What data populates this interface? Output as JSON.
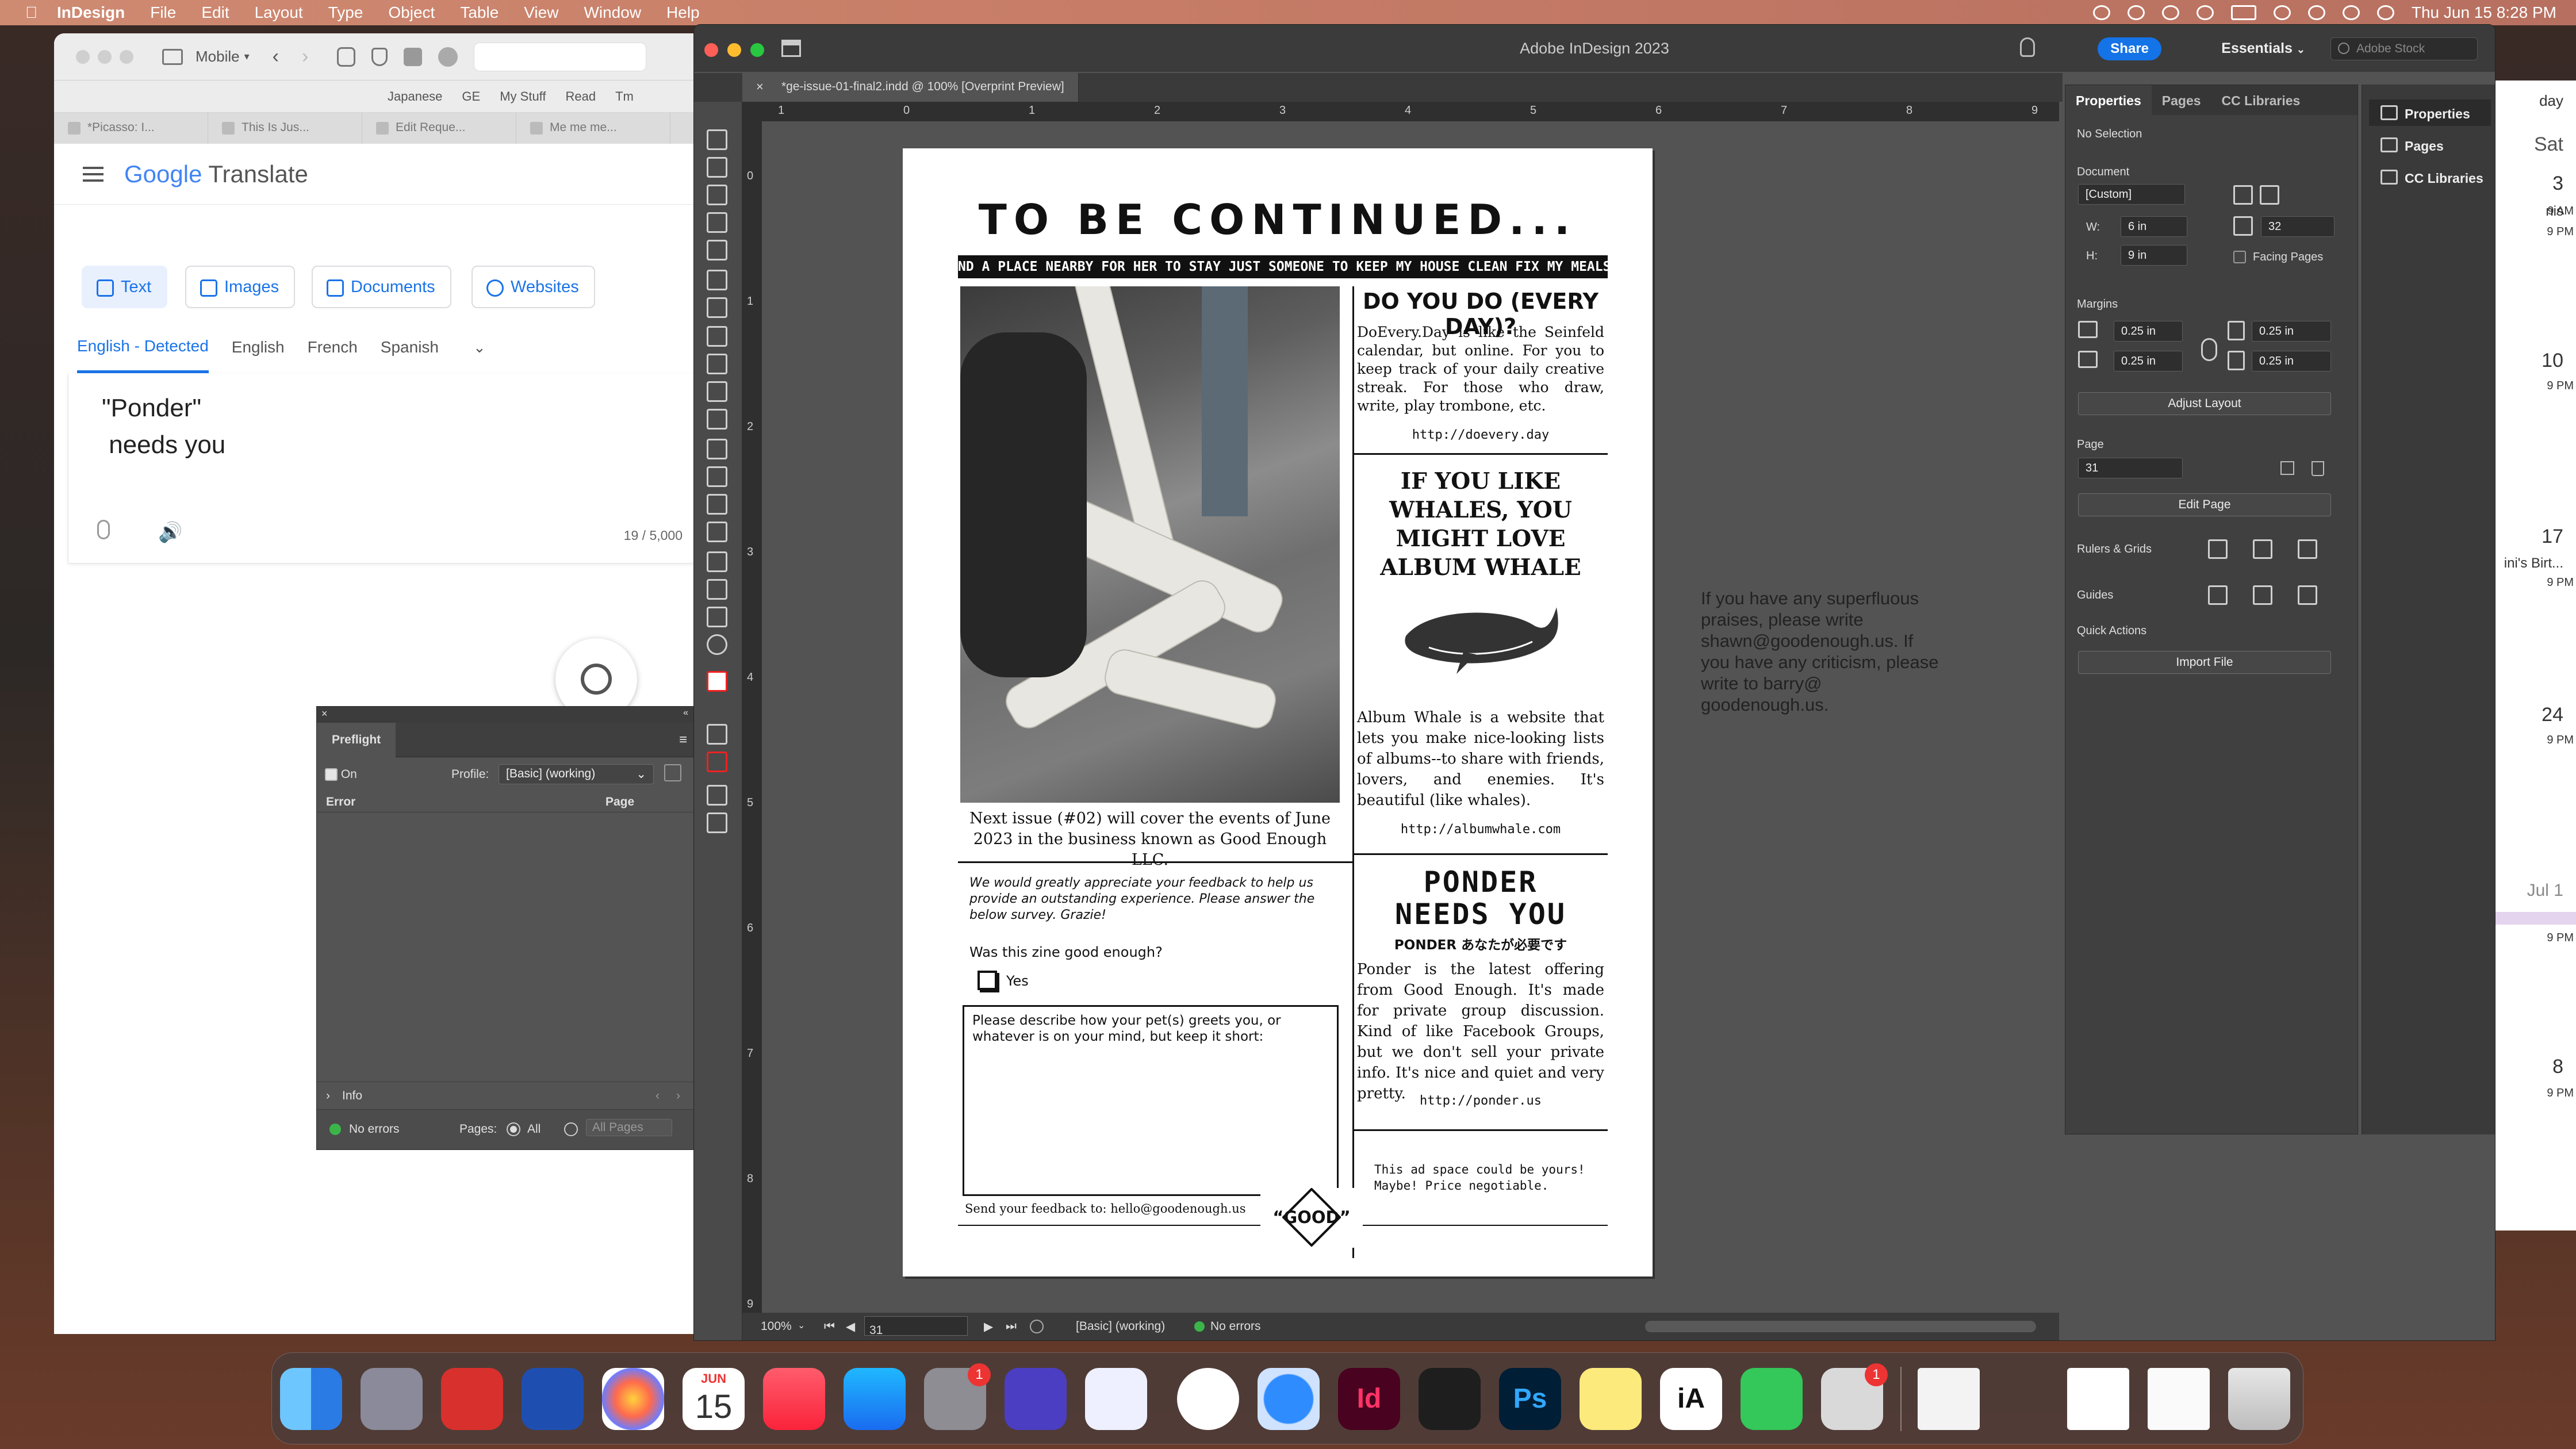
{
  "menubar": {
    "app": "InDesign",
    "items": [
      "File",
      "Edit",
      "Layout",
      "Type",
      "Object",
      "Table",
      "View",
      "Window",
      "Help"
    ],
    "datetime": "Thu Jun 15  8:28 PM"
  },
  "calendar": {
    "header_day": "day",
    "header_sat": "Sat",
    "cells": [
      {
        "date": "3",
        "line1": "nis",
        "line2": "9 AM",
        "line3": "9 PM"
      },
      {
        "date": "10",
        "line1": "",
        "line2": "9 PM",
        "line3": ""
      },
      {
        "date": "17",
        "line1": "ini's Birt...",
        "line2": "9 PM",
        "line3": ""
      },
      {
        "date": "24",
        "line1": "",
        "line2": "9 PM",
        "line3": ""
      },
      {
        "date": "Jul 1",
        "line1": "",
        "line2": "9 PM",
        "line3": ""
      },
      {
        "date": "8",
        "line1": "",
        "line2": "9 PM",
        "line3": ""
      }
    ]
  },
  "browser": {
    "mode": "Mobile",
    "bookmarks": [
      "Japanese",
      "GE",
      "My Stuff",
      "Read",
      "Tm"
    ],
    "tabs": [
      "*Picasso: I...",
      "This Is Jus...",
      "Edit Reque...",
      "Me me me..."
    ],
    "gt": {
      "logo_google": "Google",
      "logo_translate": "Translate",
      "buttons": [
        "Text",
        "Images",
        "Documents",
        "Websites"
      ],
      "langs": [
        "English - Detected",
        "English",
        "French",
        "Spanish"
      ],
      "source_text": "\"Ponder\"\n needs you",
      "char_count": "19 / 5,000"
    }
  },
  "preflight": {
    "title": "Preflight",
    "on_label": "On",
    "profile_label": "Profile:",
    "profile_value": "[Basic] (working)",
    "col_error": "Error",
    "col_page": "Page",
    "info": "Info",
    "status": "No errors",
    "pages_label": "Pages:",
    "all": "All",
    "all_pages": "All Pages"
  },
  "indesign": {
    "window_title": "Adobe InDesign 2023",
    "share": "Share",
    "workspace": "Essentials",
    "stock_placeholder": "Adobe Stock",
    "doc_tab": "*ge-issue-01-final2.indd @ 100% [Overprint Preview]",
    "ruler_h": [
      "1",
      "0",
      "1",
      "2",
      "3",
      "4",
      "5",
      "6",
      "7",
      "8",
      "9"
    ],
    "ruler_v": [
      "0",
      "1",
      "2",
      "3",
      "4",
      "5",
      "6",
      "7",
      "8",
      "9"
    ],
    "status": {
      "zoom": "100%",
      "page": "31",
      "profile": "[Basic] (working)",
      "errors": "No errors"
    },
    "properties": {
      "tabs": [
        "Properties",
        "Pages",
        "CC Libraries"
      ],
      "selection": "No Selection",
      "document": "Document",
      "preset": "[Custom]",
      "w_label": "W:",
      "w": "6 in",
      "h_label": "H:",
      "h": "9 in",
      "pages_count": "32",
      "facing": "Facing Pages",
      "margins": "Margins",
      "m_top": "0.25 in",
      "m_bottom": "0.25 in",
      "m_left": "0.25 in",
      "m_right": "0.25 in",
      "adjust": "Adjust Layout",
      "page_label": "Page",
      "page_value": "31",
      "edit_page": "Edit Page",
      "rulers": "Rulers & Grids",
      "guides": "Guides",
      "quick_actions": "Quick Actions",
      "import_file": "Import File"
    },
    "side_panels": [
      "Properties",
      "Pages",
      "CC Libraries"
    ]
  },
  "zine": {
    "title": "TO BE CONTINUED...",
    "banner": "ND A PLACE NEARBY FOR HER TO STAY JUST SOMEONE TO KEEP MY HOUSE CLEAN FIX MY MEALS AND GO",
    "caption": "Next issue (#02) will cover the events of June 2023 in the business known as Good Enough LLC.",
    "survey_intro": "We would greatly appreciate your feedback to help us provide an outstanding experience. Please answer the below survey. Grazie!",
    "question": "Was this zine good enough?",
    "yes": "Yes",
    "textbox_label": "Please describe how your pet(s) greets you, or whatever is on your mind, but keep it short:",
    "feedback": "Send your feedback to: hello@goodenough.us",
    "good": "“GOOD”",
    "doevery_head": "DO YOU DO (EVERY DAY)?",
    "doevery_body": "DoEvery.Day is like the Seinfeld calendar, but online. For you to keep track of your daily creative streak. For those who draw, write, play trombone, etc.",
    "doevery_url": "http://doevery.day",
    "whale_head": "IF YOU LIKE WHALES, YOU MIGHT LOVE ALBUM WHALE",
    "whale_body": "Album Whale is a website that lets you make nice-looking lists of albums--to share with friends, lovers, and enemies. It's beautiful (like whales).",
    "whale_url": "http://albumwhale.com",
    "ponder_head": "PONDER NEEDS YOU",
    "ponder_sub": "PONDER あなたが必要です",
    "ponder_body": "Ponder is the latest offering from Good Enough. It's made for private group discussion. Kind of like Facebook Groups, but we don't sell your private info. It's nice and quiet and very pretty.",
    "ponder_url": "http://ponder.us",
    "ad": "This ad space could be yours!\nMaybe! Price negotiable."
  },
  "pasteboard_note": "If you have any superfluous praises, please write shawn@goodenough.us. If you have any criticism, please write to barry@ goodenough.us.",
  "dock": {
    "calendar_month": "JUN",
    "calendar_day": "15",
    "badge1": "1",
    "badge2": "1"
  }
}
